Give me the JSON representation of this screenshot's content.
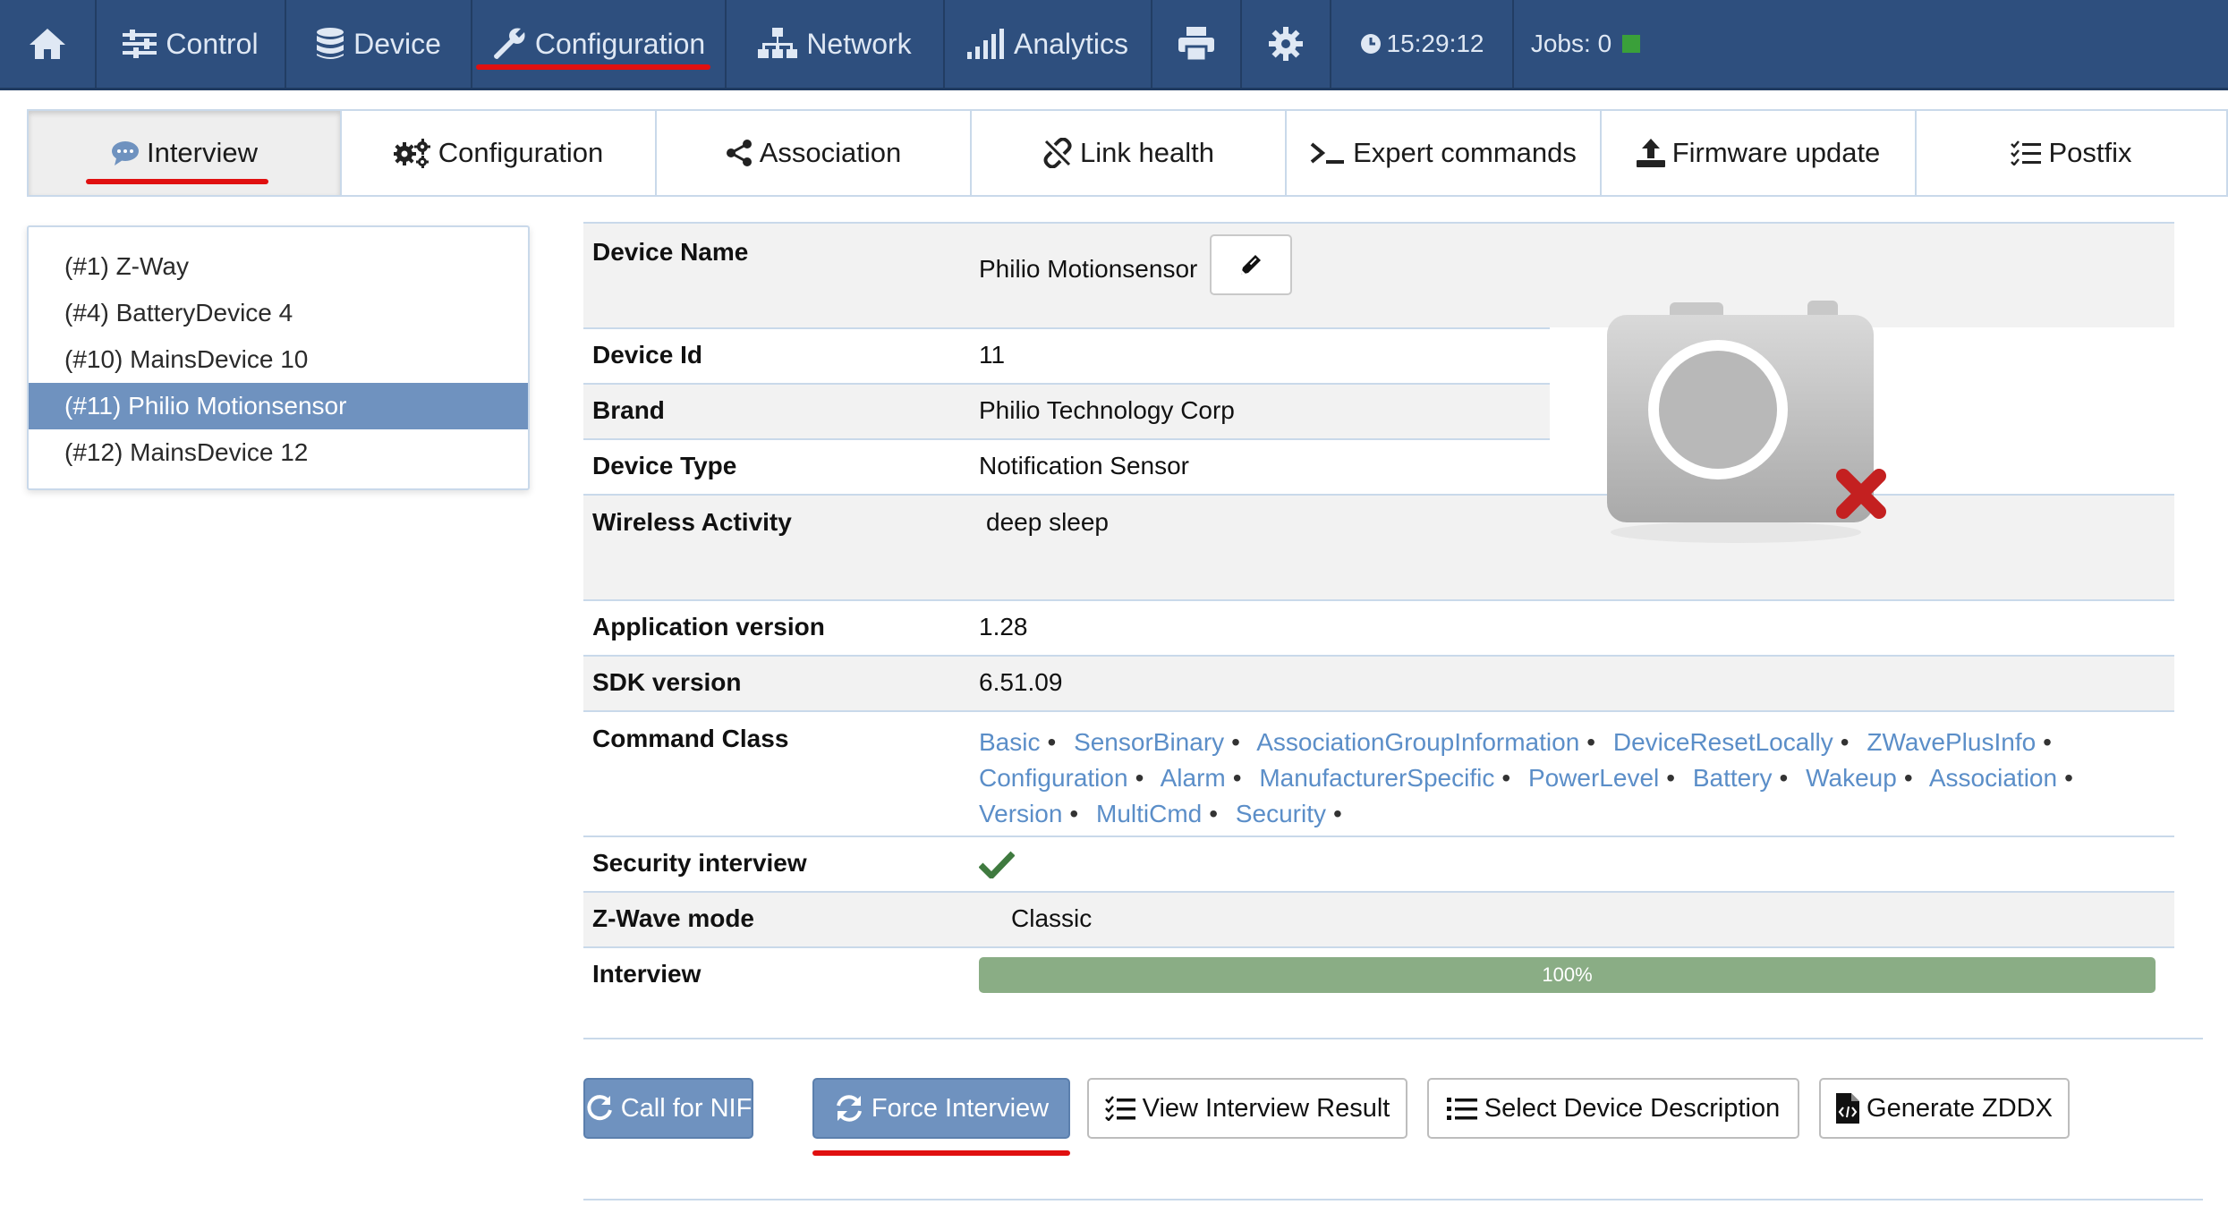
{
  "topnav": {
    "home_icon": "home-icon",
    "control": "Control",
    "device": "Device",
    "configuration": "Configuration",
    "network": "Network",
    "analytics": "Analytics",
    "print_icon": "printer-icon",
    "settings_icon": "gear-icon",
    "time": "15:29:12",
    "jobs": "Jobs: 0",
    "jobs_status_color": "#3aa03a",
    "active": "Configuration"
  },
  "subtabs": [
    {
      "label": "Interview",
      "icon": "chat-icon"
    },
    {
      "label": "Configuration",
      "icon": "gears-icon"
    },
    {
      "label": "Association",
      "icon": "share-icon"
    },
    {
      "label": "Link health",
      "icon": "broken-link-icon"
    },
    {
      "label": "Expert commands",
      "icon": "terminal-icon"
    },
    {
      "label": "Firmware update",
      "icon": "upload-icon"
    },
    {
      "label": "Postfix",
      "icon": "list-check-icon"
    }
  ],
  "device_list": [
    {
      "label": "(#1) Z-Way"
    },
    {
      "label": "(#4) BatteryDevice 4"
    },
    {
      "label": "(#10) MainsDevice 10"
    },
    {
      "label": "(#11) Philio Motionsensor",
      "active": true
    },
    {
      "label": "(#12) MainsDevice 12"
    }
  ],
  "info": {
    "device_name_label": "Device Name",
    "device_name": "Philio Motionsensor",
    "device_id_label": "Device Id",
    "device_id": "11",
    "brand_label": "Brand",
    "brand": "Philio Technology Corp",
    "device_type_label": "Device Type",
    "device_type": "Notification Sensor",
    "wireless_label": "Wireless Activity",
    "wireless": "deep sleep",
    "app_version_label": "Application version",
    "app_version": "1.28",
    "sdk_version_label": "SDK version",
    "sdk_version": "6.51.09",
    "command_class_label": "Command Class",
    "command_classes": [
      "Basic",
      "SensorBinary",
      "AssociationGroupInformation",
      "DeviceResetLocally",
      "ZWavePlusInfo",
      "Configuration",
      "Alarm",
      "ManufacturerSpecific",
      "PowerLevel",
      "Battery",
      "Wakeup",
      "Association",
      "Version",
      "MultiCmd",
      "Security"
    ],
    "security_label": "Security interview",
    "security_ok": true,
    "zwave_mode_label": "Z-Wave mode",
    "zwave_mode": "Classic",
    "interview_label": "Interview",
    "interview_progress": 1.0,
    "interview_progress_text": "100%"
  },
  "buttons": {
    "call_nif": "Call for NIF",
    "force_interview": "Force Interview",
    "view_result": "View Interview Result",
    "select_description": "Select Device Description",
    "generate_zddx": "Generate ZDDX"
  }
}
